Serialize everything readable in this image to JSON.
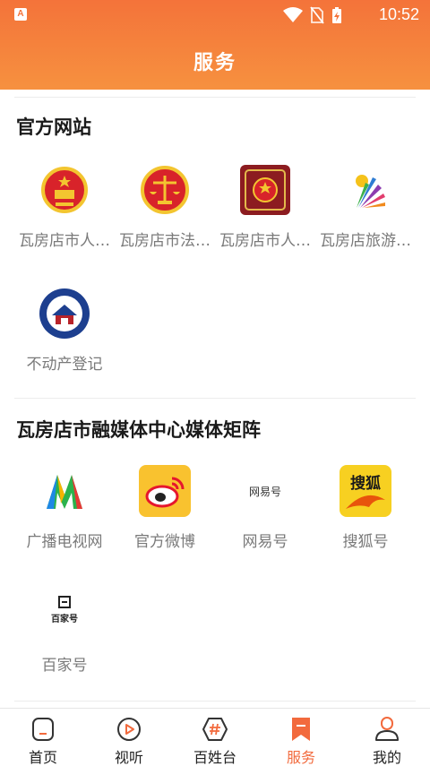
{
  "status_bar": {
    "time": "10:52",
    "app_badge": "A"
  },
  "page": {
    "title": "服务"
  },
  "sections": [
    {
      "title": "官方网站",
      "items": [
        {
          "label": "瓦房店市人…",
          "icon": "national-emblem-icon"
        },
        {
          "label": "瓦房店市法…",
          "icon": "court-emblem-icon"
        },
        {
          "label": "瓦房店市人…",
          "icon": "procuratorate-emblem-icon"
        },
        {
          "label": "瓦房店旅游…",
          "icon": "tourism-logo-icon"
        },
        {
          "label": "不动产登记",
          "icon": "real-estate-registration-icon"
        }
      ]
    },
    {
      "title": "瓦房店市融媒体中心媒体矩阵",
      "items": [
        {
          "label": "广播电视网",
          "icon": "broadcast-tv-logo-icon"
        },
        {
          "label": "官方微博",
          "icon": "weibo-icon"
        },
        {
          "label": "网易号",
          "icon": "netease-icon",
          "logo_text": "网易号"
        },
        {
          "label": "搜狐号",
          "icon": "sohu-icon",
          "logo_text": "搜狐"
        },
        {
          "label": "百家号",
          "icon": "baijia-icon",
          "logo_text": "百家号"
        }
      ]
    }
  ],
  "tabbar": [
    {
      "label": "首页",
      "icon": "home-icon",
      "active": false
    },
    {
      "label": "视听",
      "icon": "play-icon",
      "active": false
    },
    {
      "label": "百姓台",
      "icon": "hashtag-icon",
      "active": false
    },
    {
      "label": "服务",
      "icon": "bookmark-icon",
      "active": true
    },
    {
      "label": "我的",
      "icon": "user-icon",
      "active": false
    }
  ],
  "colors": {
    "accent": "#f26a3d",
    "header_top": "#f4733a",
    "header_bottom": "#f6913f"
  }
}
